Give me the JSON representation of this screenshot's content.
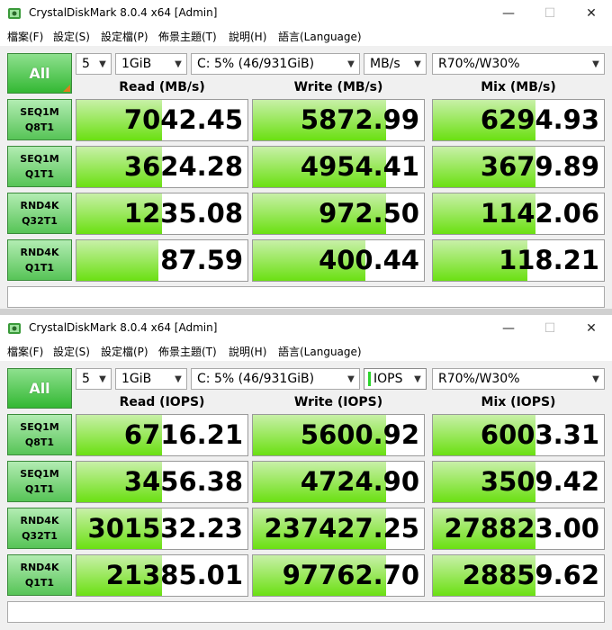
{
  "colors": {
    "accent_green": "#6be012",
    "button_green": "#57c457",
    "corner_orange": "#e07c1c"
  },
  "icons": {
    "app": "app-icon",
    "minimize": "minimize-icon",
    "maximize": "maximize-icon",
    "close": "close-icon",
    "dropdown": "chevron-down-icon"
  },
  "windows": [
    {
      "title": "CrystalDiskMark 8.0.4 x64 [Admin]",
      "menu": [
        "檔案(F)",
        "設定(S)",
        "設定檔(P)",
        "佈景主題(T)",
        "說明(H)",
        "語言(Language)"
      ],
      "all_label": "All",
      "controls": {
        "count": "5",
        "size": "1GiB",
        "drive": "C: 5% (46/931GiB)",
        "unit": "MB/s",
        "mix": "R70%/W30%"
      },
      "headers": {
        "read": "Read (MB/s)",
        "write": "Write (MB/s)",
        "mix": "Mix (MB/s)"
      },
      "rows": [
        {
          "line1": "SEQ1M",
          "line2": "Q8T1",
          "read": "7042.45",
          "write": "5872.99",
          "mix": "6294.93",
          "read_pct": 50,
          "write_pct": 78,
          "mix_pct": 60
        },
        {
          "line1": "SEQ1M",
          "line2": "Q1T1",
          "read": "3624.28",
          "write": "4954.41",
          "mix": "3679.89",
          "read_pct": 50,
          "write_pct": 78,
          "mix_pct": 60
        },
        {
          "line1": "RND4K",
          "line2": "Q32T1",
          "read": "1235.08",
          "write": "972.50",
          "mix": "1142.06",
          "read_pct": 50,
          "write_pct": 78,
          "mix_pct": 60
        },
        {
          "line1": "RND4K",
          "line2": "Q1T1",
          "read": "87.59",
          "write": "400.44",
          "mix": "118.21",
          "read_pct": 48,
          "write_pct": 66,
          "mix_pct": 55
        }
      ],
      "status": ""
    },
    {
      "title": "CrystalDiskMark 8.0.4 x64 [Admin]",
      "menu": [
        "檔案(F)",
        "設定(S)",
        "設定檔(P)",
        "佈景主題(T)",
        "說明(H)",
        "語言(Language)"
      ],
      "all_label": "All",
      "controls": {
        "count": "5",
        "size": "1GiB",
        "drive": "C: 5% (46/931GiB)",
        "unit": "IOPS",
        "mix": "R70%/W30%"
      },
      "headers": {
        "read": "Read (IOPS)",
        "write": "Write (IOPS)",
        "mix": "Mix (IOPS)"
      },
      "rows": [
        {
          "line1": "SEQ1M",
          "line2": "Q8T1",
          "read": "6716.21",
          "write": "5600.92",
          "mix": "6003.31",
          "read_pct": 50,
          "write_pct": 78,
          "mix_pct": 60
        },
        {
          "line1": "SEQ1M",
          "line2": "Q1T1",
          "read": "3456.38",
          "write": "4724.90",
          "mix": "3509.42",
          "read_pct": 50,
          "write_pct": 78,
          "mix_pct": 60
        },
        {
          "line1": "RND4K",
          "line2": "Q32T1",
          "read": "301532.23",
          "write": "237427.25",
          "mix": "278823.00",
          "read_pct": 50,
          "write_pct": 78,
          "mix_pct": 60
        },
        {
          "line1": "RND4K",
          "line2": "Q1T1",
          "read": "21385.01",
          "write": "97762.70",
          "mix": "28859.62",
          "read_pct": 50,
          "write_pct": 78,
          "mix_pct": 60
        }
      ],
      "status": ""
    }
  ]
}
